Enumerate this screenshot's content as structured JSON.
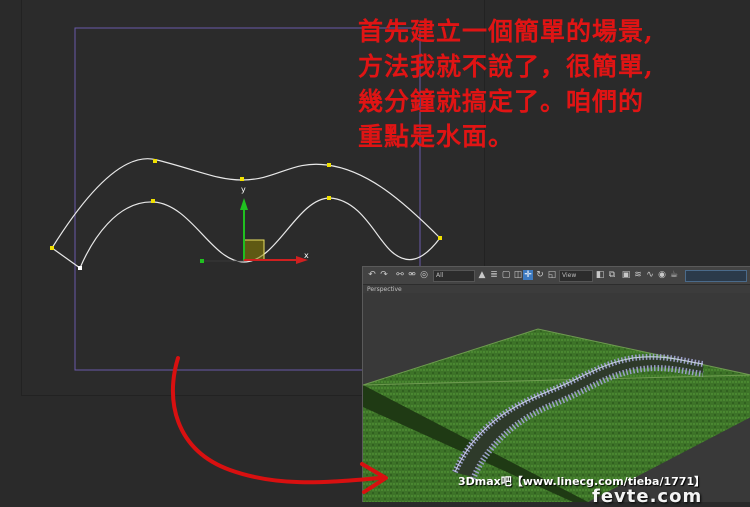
{
  "annotation": {
    "lines": [
      "首先建立一個簡單的場景,",
      "方法我就不說了，很簡單,",
      "幾分鐘就搞定了。咱們的",
      "重點是水面。"
    ],
    "color": "#e01414"
  },
  "top_viewport": {
    "axis_y_label": "y",
    "axis_x_label": "x",
    "gizmo_icon": "move-gizmo-icon",
    "spline_color": "#e8e8e8",
    "vertex_color": "#f0e000",
    "frame_color": "#6a5aa8"
  },
  "render_window": {
    "viewport_label": "Perspective",
    "toolbar_dropdown_1": "All",
    "toolbar_dropdown_2": "View",
    "grass_color": "#3f7a2a",
    "fence_color": "#9aa0c8",
    "toolbar_icons": [
      "undo-icon",
      "redo-icon",
      "link-icon",
      "unlink-icon",
      "bind-icon",
      "select-filter-icon",
      "select-icon",
      "select-name-icon",
      "rect-select-icon",
      "window-crossing-icon",
      "move-icon",
      "rotate-icon",
      "scale-icon",
      "reference-coord-icon",
      "pivot-icon",
      "mirror-icon",
      "align-icon",
      "layers-icon",
      "curve-editor-icon",
      "schematic-icon",
      "material-editor-icon",
      "render-setup-icon",
      "render-frame-icon",
      "render-icon"
    ]
  },
  "footer": {
    "text": "3Dmax吧【www.linecg.com/tieba/1771】",
    "watermark": "fevte.com"
  },
  "arrow_color": "#d81010"
}
